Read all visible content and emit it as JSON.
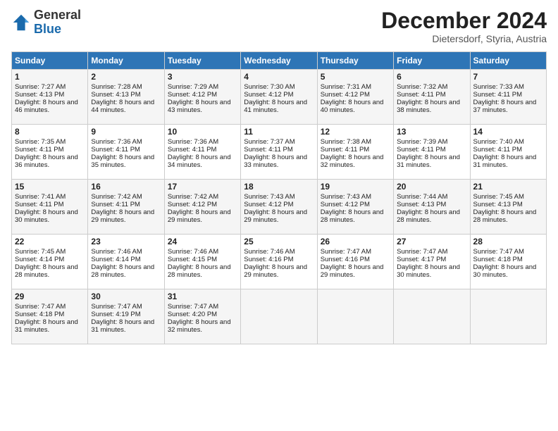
{
  "header": {
    "logo_general": "General",
    "logo_blue": "Blue",
    "month_title": "December 2024",
    "subtitle": "Dietersdorf, Styria, Austria"
  },
  "days_of_week": [
    "Sunday",
    "Monday",
    "Tuesday",
    "Wednesday",
    "Thursday",
    "Friday",
    "Saturday"
  ],
  "weeks": [
    [
      {
        "day": "1",
        "sunrise": "Sunrise: 7:27 AM",
        "sunset": "Sunset: 4:13 PM",
        "daylight": "Daylight: 8 hours and 46 minutes."
      },
      {
        "day": "2",
        "sunrise": "Sunrise: 7:28 AM",
        "sunset": "Sunset: 4:13 PM",
        "daylight": "Daylight: 8 hours and 44 minutes."
      },
      {
        "day": "3",
        "sunrise": "Sunrise: 7:29 AM",
        "sunset": "Sunset: 4:12 PM",
        "daylight": "Daylight: 8 hours and 43 minutes."
      },
      {
        "day": "4",
        "sunrise": "Sunrise: 7:30 AM",
        "sunset": "Sunset: 4:12 PM",
        "daylight": "Daylight: 8 hours and 41 minutes."
      },
      {
        "day": "5",
        "sunrise": "Sunrise: 7:31 AM",
        "sunset": "Sunset: 4:12 PM",
        "daylight": "Daylight: 8 hours and 40 minutes."
      },
      {
        "day": "6",
        "sunrise": "Sunrise: 7:32 AM",
        "sunset": "Sunset: 4:11 PM",
        "daylight": "Daylight: 8 hours and 38 minutes."
      },
      {
        "day": "7",
        "sunrise": "Sunrise: 7:33 AM",
        "sunset": "Sunset: 4:11 PM",
        "daylight": "Daylight: 8 hours and 37 minutes."
      }
    ],
    [
      {
        "day": "8",
        "sunrise": "Sunrise: 7:35 AM",
        "sunset": "Sunset: 4:11 PM",
        "daylight": "Daylight: 8 hours and 36 minutes."
      },
      {
        "day": "9",
        "sunrise": "Sunrise: 7:36 AM",
        "sunset": "Sunset: 4:11 PM",
        "daylight": "Daylight: 8 hours and 35 minutes."
      },
      {
        "day": "10",
        "sunrise": "Sunrise: 7:36 AM",
        "sunset": "Sunset: 4:11 PM",
        "daylight": "Daylight: 8 hours and 34 minutes."
      },
      {
        "day": "11",
        "sunrise": "Sunrise: 7:37 AM",
        "sunset": "Sunset: 4:11 PM",
        "daylight": "Daylight: 8 hours and 33 minutes."
      },
      {
        "day": "12",
        "sunrise": "Sunrise: 7:38 AM",
        "sunset": "Sunset: 4:11 PM",
        "daylight": "Daylight: 8 hours and 32 minutes."
      },
      {
        "day": "13",
        "sunrise": "Sunrise: 7:39 AM",
        "sunset": "Sunset: 4:11 PM",
        "daylight": "Daylight: 8 hours and 31 minutes."
      },
      {
        "day": "14",
        "sunrise": "Sunrise: 7:40 AM",
        "sunset": "Sunset: 4:11 PM",
        "daylight": "Daylight: 8 hours and 31 minutes."
      }
    ],
    [
      {
        "day": "15",
        "sunrise": "Sunrise: 7:41 AM",
        "sunset": "Sunset: 4:11 PM",
        "daylight": "Daylight: 8 hours and 30 minutes."
      },
      {
        "day": "16",
        "sunrise": "Sunrise: 7:42 AM",
        "sunset": "Sunset: 4:11 PM",
        "daylight": "Daylight: 8 hours and 29 minutes."
      },
      {
        "day": "17",
        "sunrise": "Sunrise: 7:42 AM",
        "sunset": "Sunset: 4:12 PM",
        "daylight": "Daylight: 8 hours and 29 minutes."
      },
      {
        "day": "18",
        "sunrise": "Sunrise: 7:43 AM",
        "sunset": "Sunset: 4:12 PM",
        "daylight": "Daylight: 8 hours and 29 minutes."
      },
      {
        "day": "19",
        "sunrise": "Sunrise: 7:43 AM",
        "sunset": "Sunset: 4:12 PM",
        "daylight": "Daylight: 8 hours and 28 minutes."
      },
      {
        "day": "20",
        "sunrise": "Sunrise: 7:44 AM",
        "sunset": "Sunset: 4:13 PM",
        "daylight": "Daylight: 8 hours and 28 minutes."
      },
      {
        "day": "21",
        "sunrise": "Sunrise: 7:45 AM",
        "sunset": "Sunset: 4:13 PM",
        "daylight": "Daylight: 8 hours and 28 minutes."
      }
    ],
    [
      {
        "day": "22",
        "sunrise": "Sunrise: 7:45 AM",
        "sunset": "Sunset: 4:14 PM",
        "daylight": "Daylight: 8 hours and 28 minutes."
      },
      {
        "day": "23",
        "sunrise": "Sunrise: 7:46 AM",
        "sunset": "Sunset: 4:14 PM",
        "daylight": "Daylight: 8 hours and 28 minutes."
      },
      {
        "day": "24",
        "sunrise": "Sunrise: 7:46 AM",
        "sunset": "Sunset: 4:15 PM",
        "daylight": "Daylight: 8 hours and 28 minutes."
      },
      {
        "day": "25",
        "sunrise": "Sunrise: 7:46 AM",
        "sunset": "Sunset: 4:16 PM",
        "daylight": "Daylight: 8 hours and 29 minutes."
      },
      {
        "day": "26",
        "sunrise": "Sunrise: 7:47 AM",
        "sunset": "Sunset: 4:16 PM",
        "daylight": "Daylight: 8 hours and 29 minutes."
      },
      {
        "day": "27",
        "sunrise": "Sunrise: 7:47 AM",
        "sunset": "Sunset: 4:17 PM",
        "daylight": "Daylight: 8 hours and 30 minutes."
      },
      {
        "day": "28",
        "sunrise": "Sunrise: 7:47 AM",
        "sunset": "Sunset: 4:18 PM",
        "daylight": "Daylight: 8 hours and 30 minutes."
      }
    ],
    [
      {
        "day": "29",
        "sunrise": "Sunrise: 7:47 AM",
        "sunset": "Sunset: 4:18 PM",
        "daylight": "Daylight: 8 hours and 31 minutes."
      },
      {
        "day": "30",
        "sunrise": "Sunrise: 7:47 AM",
        "sunset": "Sunset: 4:19 PM",
        "daylight": "Daylight: 8 hours and 31 minutes."
      },
      {
        "day": "31",
        "sunrise": "Sunrise: 7:47 AM",
        "sunset": "Sunset: 4:20 PM",
        "daylight": "Daylight: 8 hours and 32 minutes."
      },
      null,
      null,
      null,
      null
    ]
  ]
}
